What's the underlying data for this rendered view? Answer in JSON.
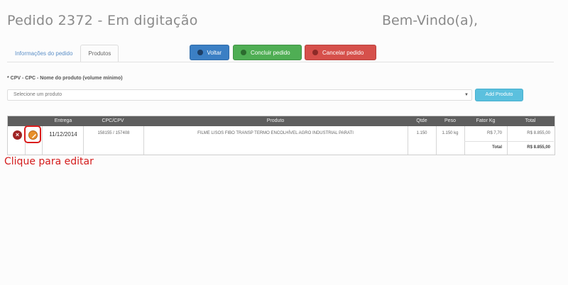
{
  "header": {
    "title": "Pedido 2372 - Em digitação",
    "welcome": "Bem-Vindo(a),"
  },
  "tabs": [
    {
      "label": "Informações do pedido",
      "active": false
    },
    {
      "label": "Produtos",
      "active": true
    }
  ],
  "actions": {
    "back_label": "Voltar",
    "finish_label": "Concluir pedido",
    "cancel_label": "Cancelar pedido"
  },
  "product_search": {
    "label": "* CPV - CPC - Nome do produto (volume mínimo)",
    "select_value": "Selecione um produto",
    "add_label": "Add Produto"
  },
  "table": {
    "columns": [
      "",
      "",
      "Entrega",
      "CPC/CPV",
      "Produto",
      "Qtde",
      "Peso",
      "Fator Kg",
      "Total"
    ],
    "rows": [
      {
        "entrega": "11/12/2014",
        "cpc_cpv": "158155 / 157408",
        "produto": "FILME LISOS FIBO TRANSP TERMO ENCOLHÍVEL AGRO INDUSTRIAL PARATI",
        "qtde": "1.150",
        "peso": "1.150 kg",
        "fator": "R$ 7,70",
        "total": "R$ 8.855,00"
      }
    ],
    "total_label": "Total",
    "total_value": "R$ 8.855,00"
  },
  "annotation": "Clique para editar",
  "colors": {
    "primary": "#3b7fc4",
    "success": "#4fae54",
    "danger": "#d6504b",
    "info": "#5bc0de",
    "annotation": "#d41c1c"
  }
}
